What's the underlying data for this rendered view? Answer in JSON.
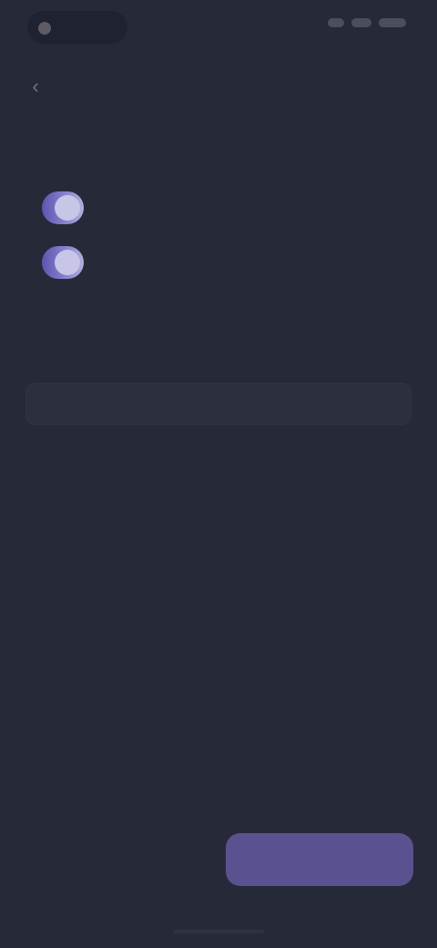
{
  "icons": {
    "back": "arrow-left",
    "status": "status-dot"
  },
  "colors": {
    "background": "#262a38",
    "accent": "#5a5190",
    "radio_gradient_start": "#5e54b0",
    "radio_gradient_end": "#b3b0de"
  },
  "status_bar": {
    "time": ""
  },
  "top_bar": {
    "title": "",
    "back_glyph": "‹"
  },
  "section": {
    "heading": "",
    "options": [
      {
        "label": "",
        "value": "",
        "selected": true
      },
      {
        "label": "",
        "value": "",
        "selected": true
      }
    ]
  },
  "section2": {
    "title": "",
    "subtitle": "",
    "field_value": ""
  },
  "actions": {
    "primary_label": ""
  }
}
